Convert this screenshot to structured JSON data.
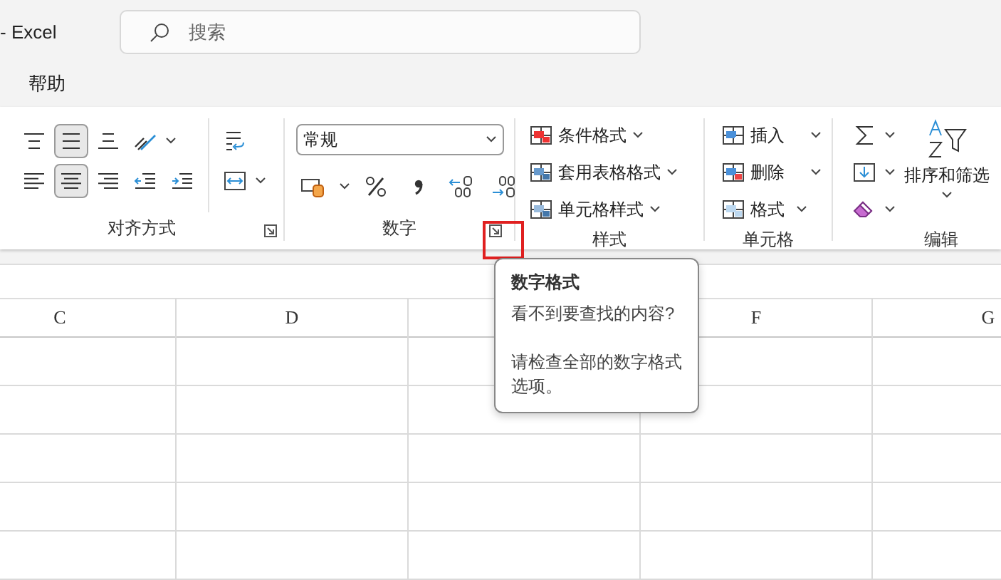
{
  "window": {
    "title": "- Excel"
  },
  "search": {
    "placeholder": "搜索"
  },
  "menu": [
    {
      "label": "帮助"
    }
  ],
  "ribbon": {
    "alignment": {
      "label": "对齐方式",
      "top_selected": [
        false,
        true,
        false
      ],
      "horizontal_selected": [
        false,
        true,
        false
      ]
    },
    "number": {
      "label": "数字",
      "format": "常规",
      "launcher_highlighted": true
    },
    "styles": {
      "label": "样式",
      "items": [
        {
          "label": "条件格式"
        },
        {
          "label": "套用表格格式"
        },
        {
          "label": "单元格样式"
        }
      ]
    },
    "cells": {
      "label": "单元格",
      "items": [
        {
          "label": "插入"
        },
        {
          "label": "删除"
        },
        {
          "label": "格式"
        }
      ]
    },
    "editing": {
      "label": "编辑",
      "sort_filter": "排序和筛选"
    }
  },
  "columns": [
    {
      "kind": "header",
      "label": "C"
    },
    {
      "kind": "header",
      "label": "D"
    },
    {
      "kind": "covered"
    },
    {
      "kind": "header",
      "label": "F"
    },
    {
      "kind": "header",
      "label": "G"
    }
  ],
  "tooltip": {
    "title": "数字格式",
    "lines": [
      "看不到要查找的内容?",
      "请检查全部的数字格式选项。"
    ]
  }
}
